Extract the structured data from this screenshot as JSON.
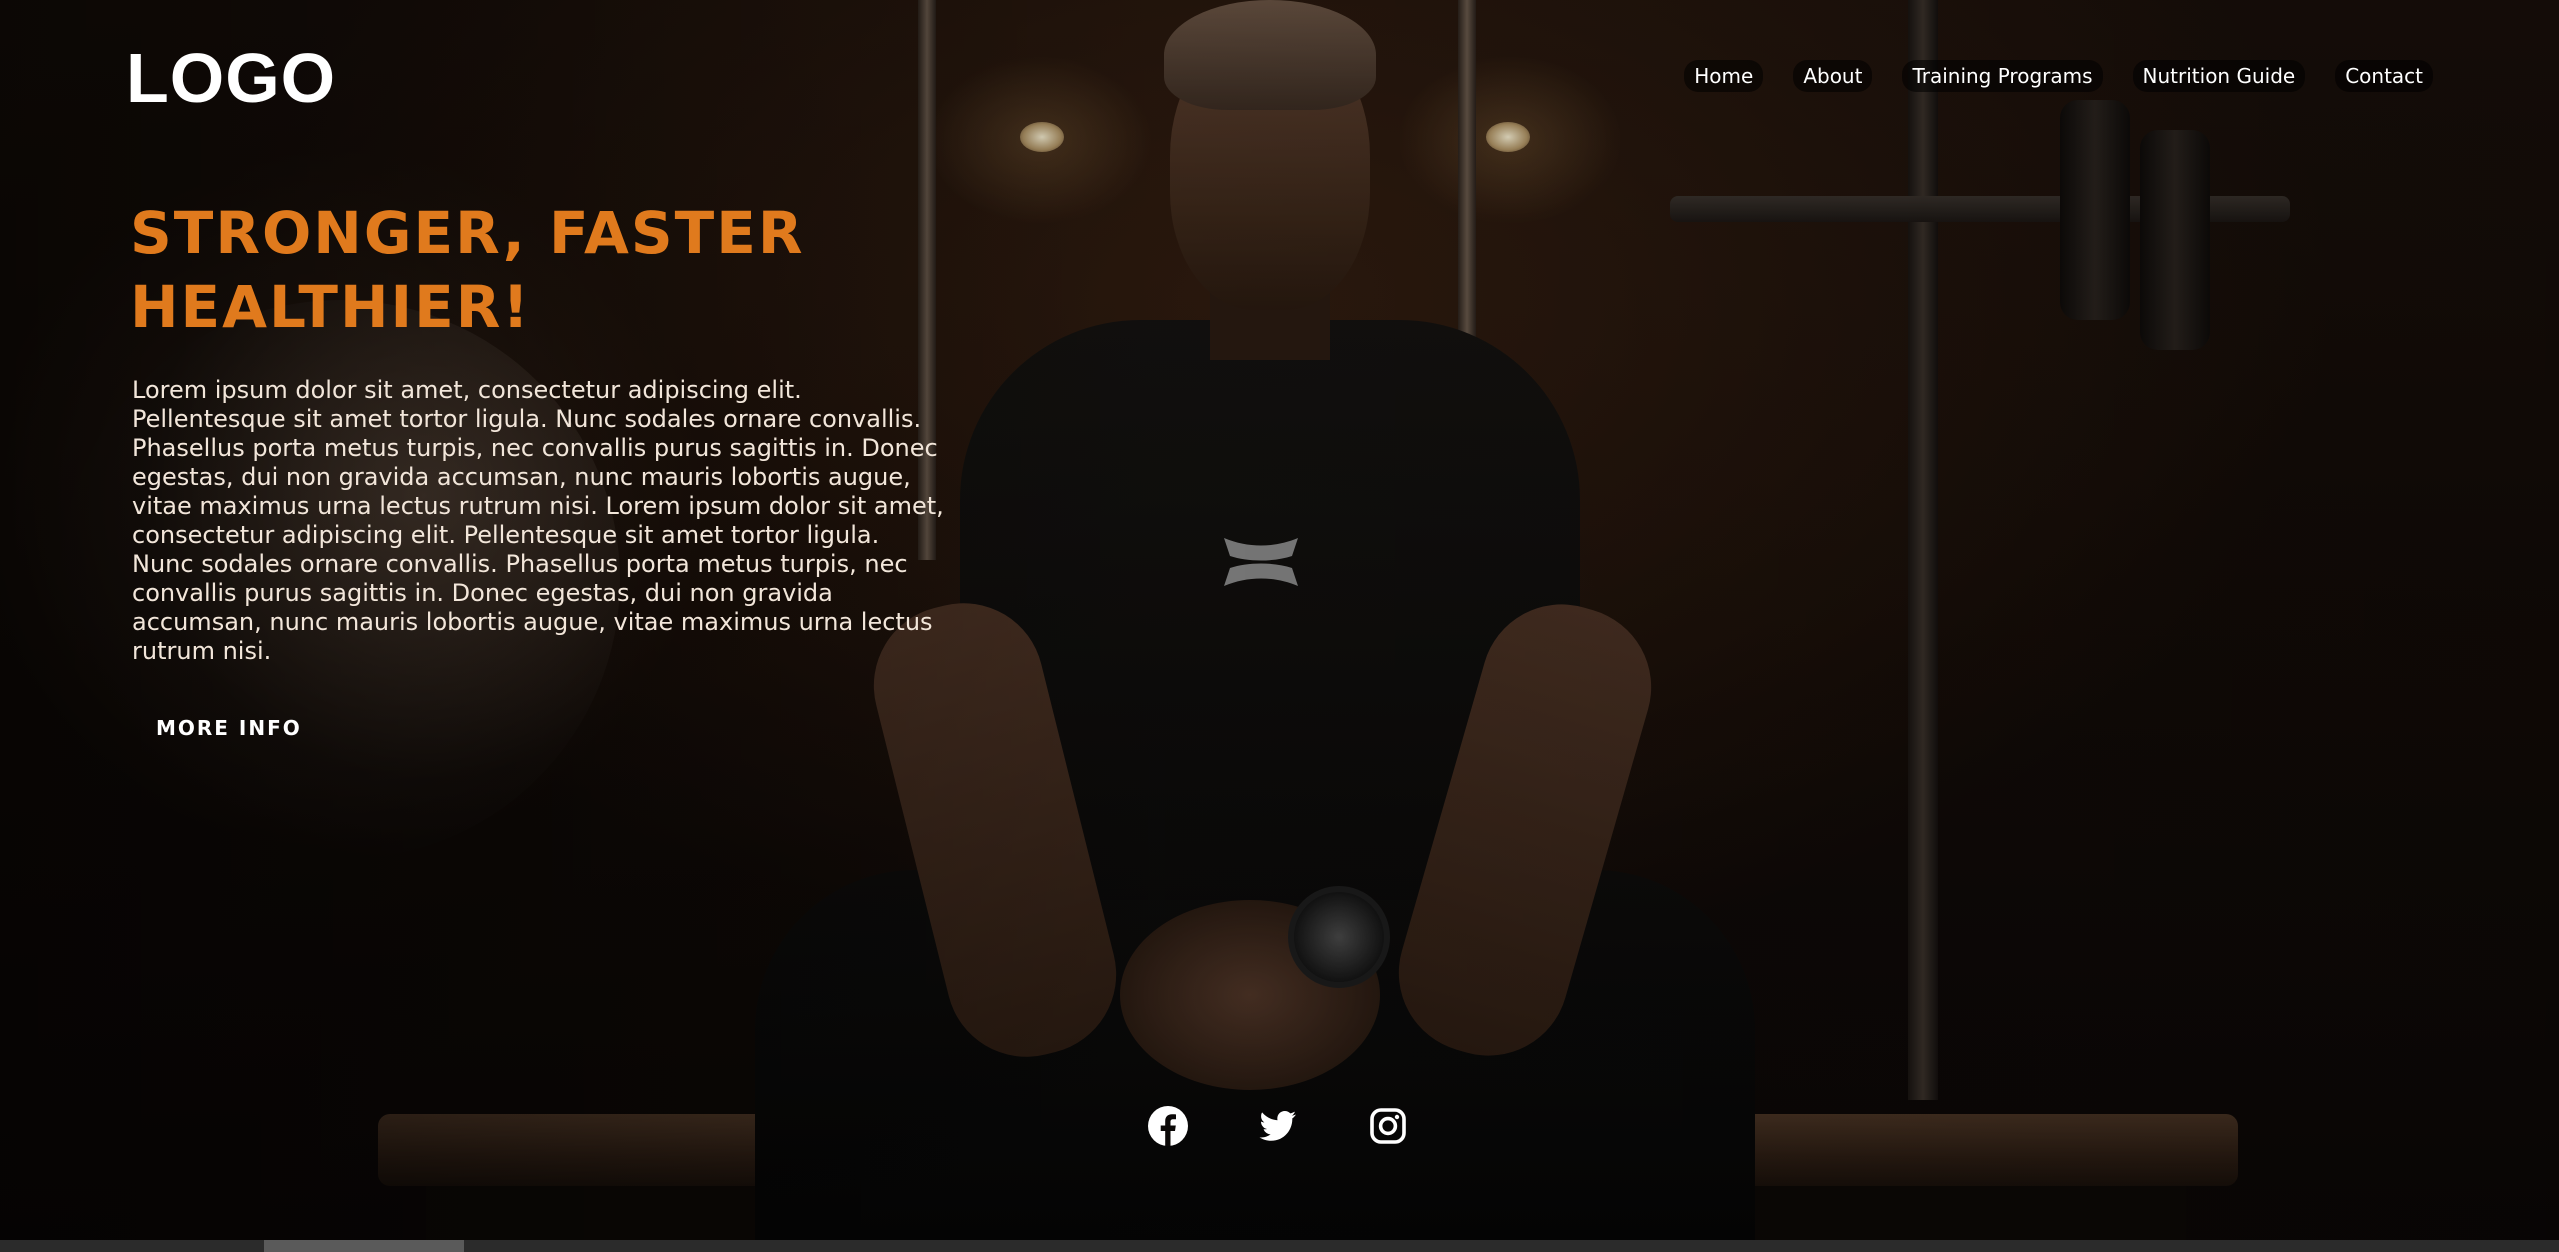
{
  "header": {
    "logo": "LOGO",
    "nav": [
      {
        "label": "Home"
      },
      {
        "label": "About"
      },
      {
        "label": "Training Programs"
      },
      {
        "label": "Nutrition Guide"
      },
      {
        "label": "Contact"
      }
    ]
  },
  "hero": {
    "title": "STRONGER, FASTER HEALTHIER!",
    "text": "Lorem ipsum dolor sit amet, consectetur adipiscing elit. Pellentesque sit amet tortor ligula. Nunc sodales ornare convallis. Phasellus porta metus turpis, nec convallis purus sagittis in. Donec egestas, dui non gravida accumsan, nunc mauris lobortis augue, vitae maximus urna lectus rutrum nisi. Lorem ipsum dolor sit amet, consectetur adipiscing elit. Pellentesque sit amet tortor ligula. Nunc sodales ornare convallis. Phasellus porta metus turpis, nec convallis purus sagittis in. Donec egestas, dui non gravida accumsan, nunc mauris lobortis augue, vitae maximus urna lectus rutrum nisi.",
    "button_label": "MORE INFO"
  },
  "social": {
    "icons": [
      "facebook-icon",
      "twitter-icon",
      "instagram-icon"
    ]
  },
  "colors": {
    "accent": "#e07a1d",
    "text_light": "#f2e6da",
    "nav_text": "#ffffff"
  }
}
